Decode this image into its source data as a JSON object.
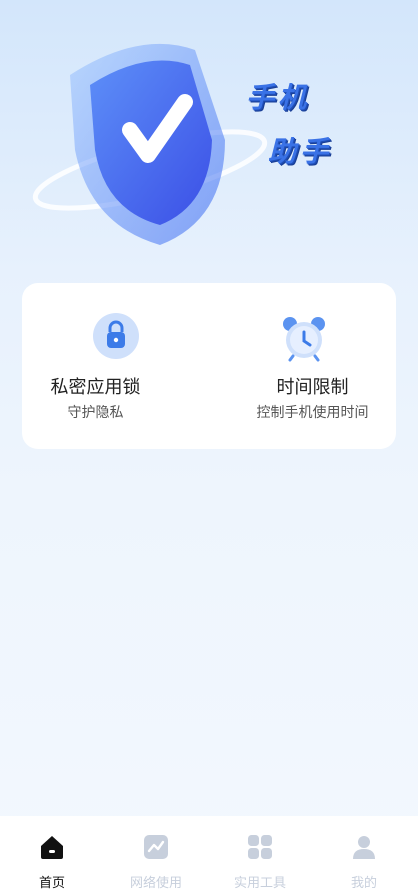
{
  "hero": {
    "line1": "手机",
    "line2": "助手"
  },
  "features": [
    {
      "title": "私密应用锁",
      "subtitle": "守护隐私",
      "icon": "lock-icon"
    },
    {
      "title": "时间限制",
      "subtitle": "控制手机使用时间",
      "icon": "alarm-clock-icon"
    }
  ],
  "tabs": [
    {
      "label": "首页",
      "icon": "home-icon",
      "active": true
    },
    {
      "label": "网络使用",
      "icon": "chart-icon",
      "active": false
    },
    {
      "label": "实用工具",
      "icon": "grid-icon",
      "active": false
    },
    {
      "label": "我的",
      "icon": "person-icon",
      "active": false
    }
  ],
  "colors": {
    "accent": "#3a72e6",
    "tab_active": "#111111",
    "tab_inactive": "#c7cfdc"
  }
}
